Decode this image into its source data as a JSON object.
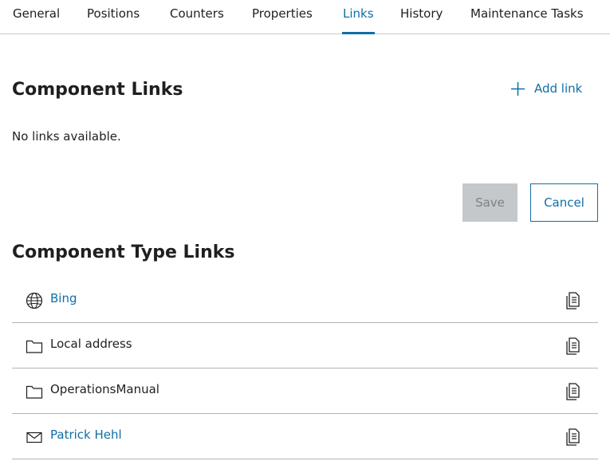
{
  "tabs": [
    {
      "label": "General",
      "active": false
    },
    {
      "label": "Positions",
      "active": false
    },
    {
      "label": "Counters",
      "active": false
    },
    {
      "label": "Properties",
      "active": false
    },
    {
      "label": "Links",
      "active": true
    },
    {
      "label": "History",
      "active": false
    },
    {
      "label": "Maintenance Tasks",
      "active": false
    }
  ],
  "component_links": {
    "title": "Component Links",
    "add_label": "Add link",
    "empty_text": "No links available."
  },
  "actions": {
    "save_label": "Save",
    "cancel_label": "Cancel"
  },
  "component_type_links": {
    "title": "Component Type Links",
    "items": [
      {
        "label": "Bing",
        "icon": "globe-icon",
        "is_link": true
      },
      {
        "label": "Local address",
        "icon": "folder-icon",
        "is_link": false
      },
      {
        "label": "OperationsManual",
        "icon": "folder-icon",
        "is_link": false
      },
      {
        "label": "Patrick Hehl",
        "icon": "mail-icon",
        "is_link": true
      }
    ]
  },
  "colors": {
    "accent": "#0f6fa6",
    "text": "#1f1f1f",
    "disabled_bg": "#c5c8cb",
    "disabled_text": "#7d8185",
    "divider": "#b5b5b5"
  }
}
